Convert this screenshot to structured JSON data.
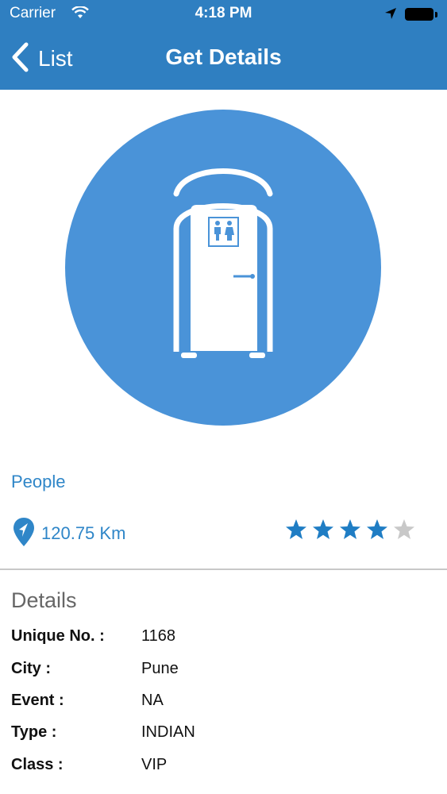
{
  "status_bar": {
    "carrier": "Carrier",
    "time": "4:18 PM"
  },
  "nav": {
    "back_label": "List",
    "title": "Get Details"
  },
  "hero": {
    "icon": "portable-toilet-icon",
    "background": "#4a93d8"
  },
  "category": "People",
  "distance": "120.75 Km",
  "rating": {
    "value": 4,
    "max": 5,
    "filled_color": "#1f7dc4",
    "empty_color": "#c8c8c8"
  },
  "details": {
    "title": "Details",
    "rows": [
      {
        "label": "Unique No. :",
        "value": "1168"
      },
      {
        "label": "City :",
        "value": "Pune"
      },
      {
        "label": "Event :",
        "value": "NA"
      },
      {
        "label": "Type :",
        "value": "INDIAN"
      },
      {
        "label": "Class :",
        "value": "VIP"
      }
    ]
  },
  "colors": {
    "header": "#2f7fc1",
    "accent": "#2f86c8"
  }
}
